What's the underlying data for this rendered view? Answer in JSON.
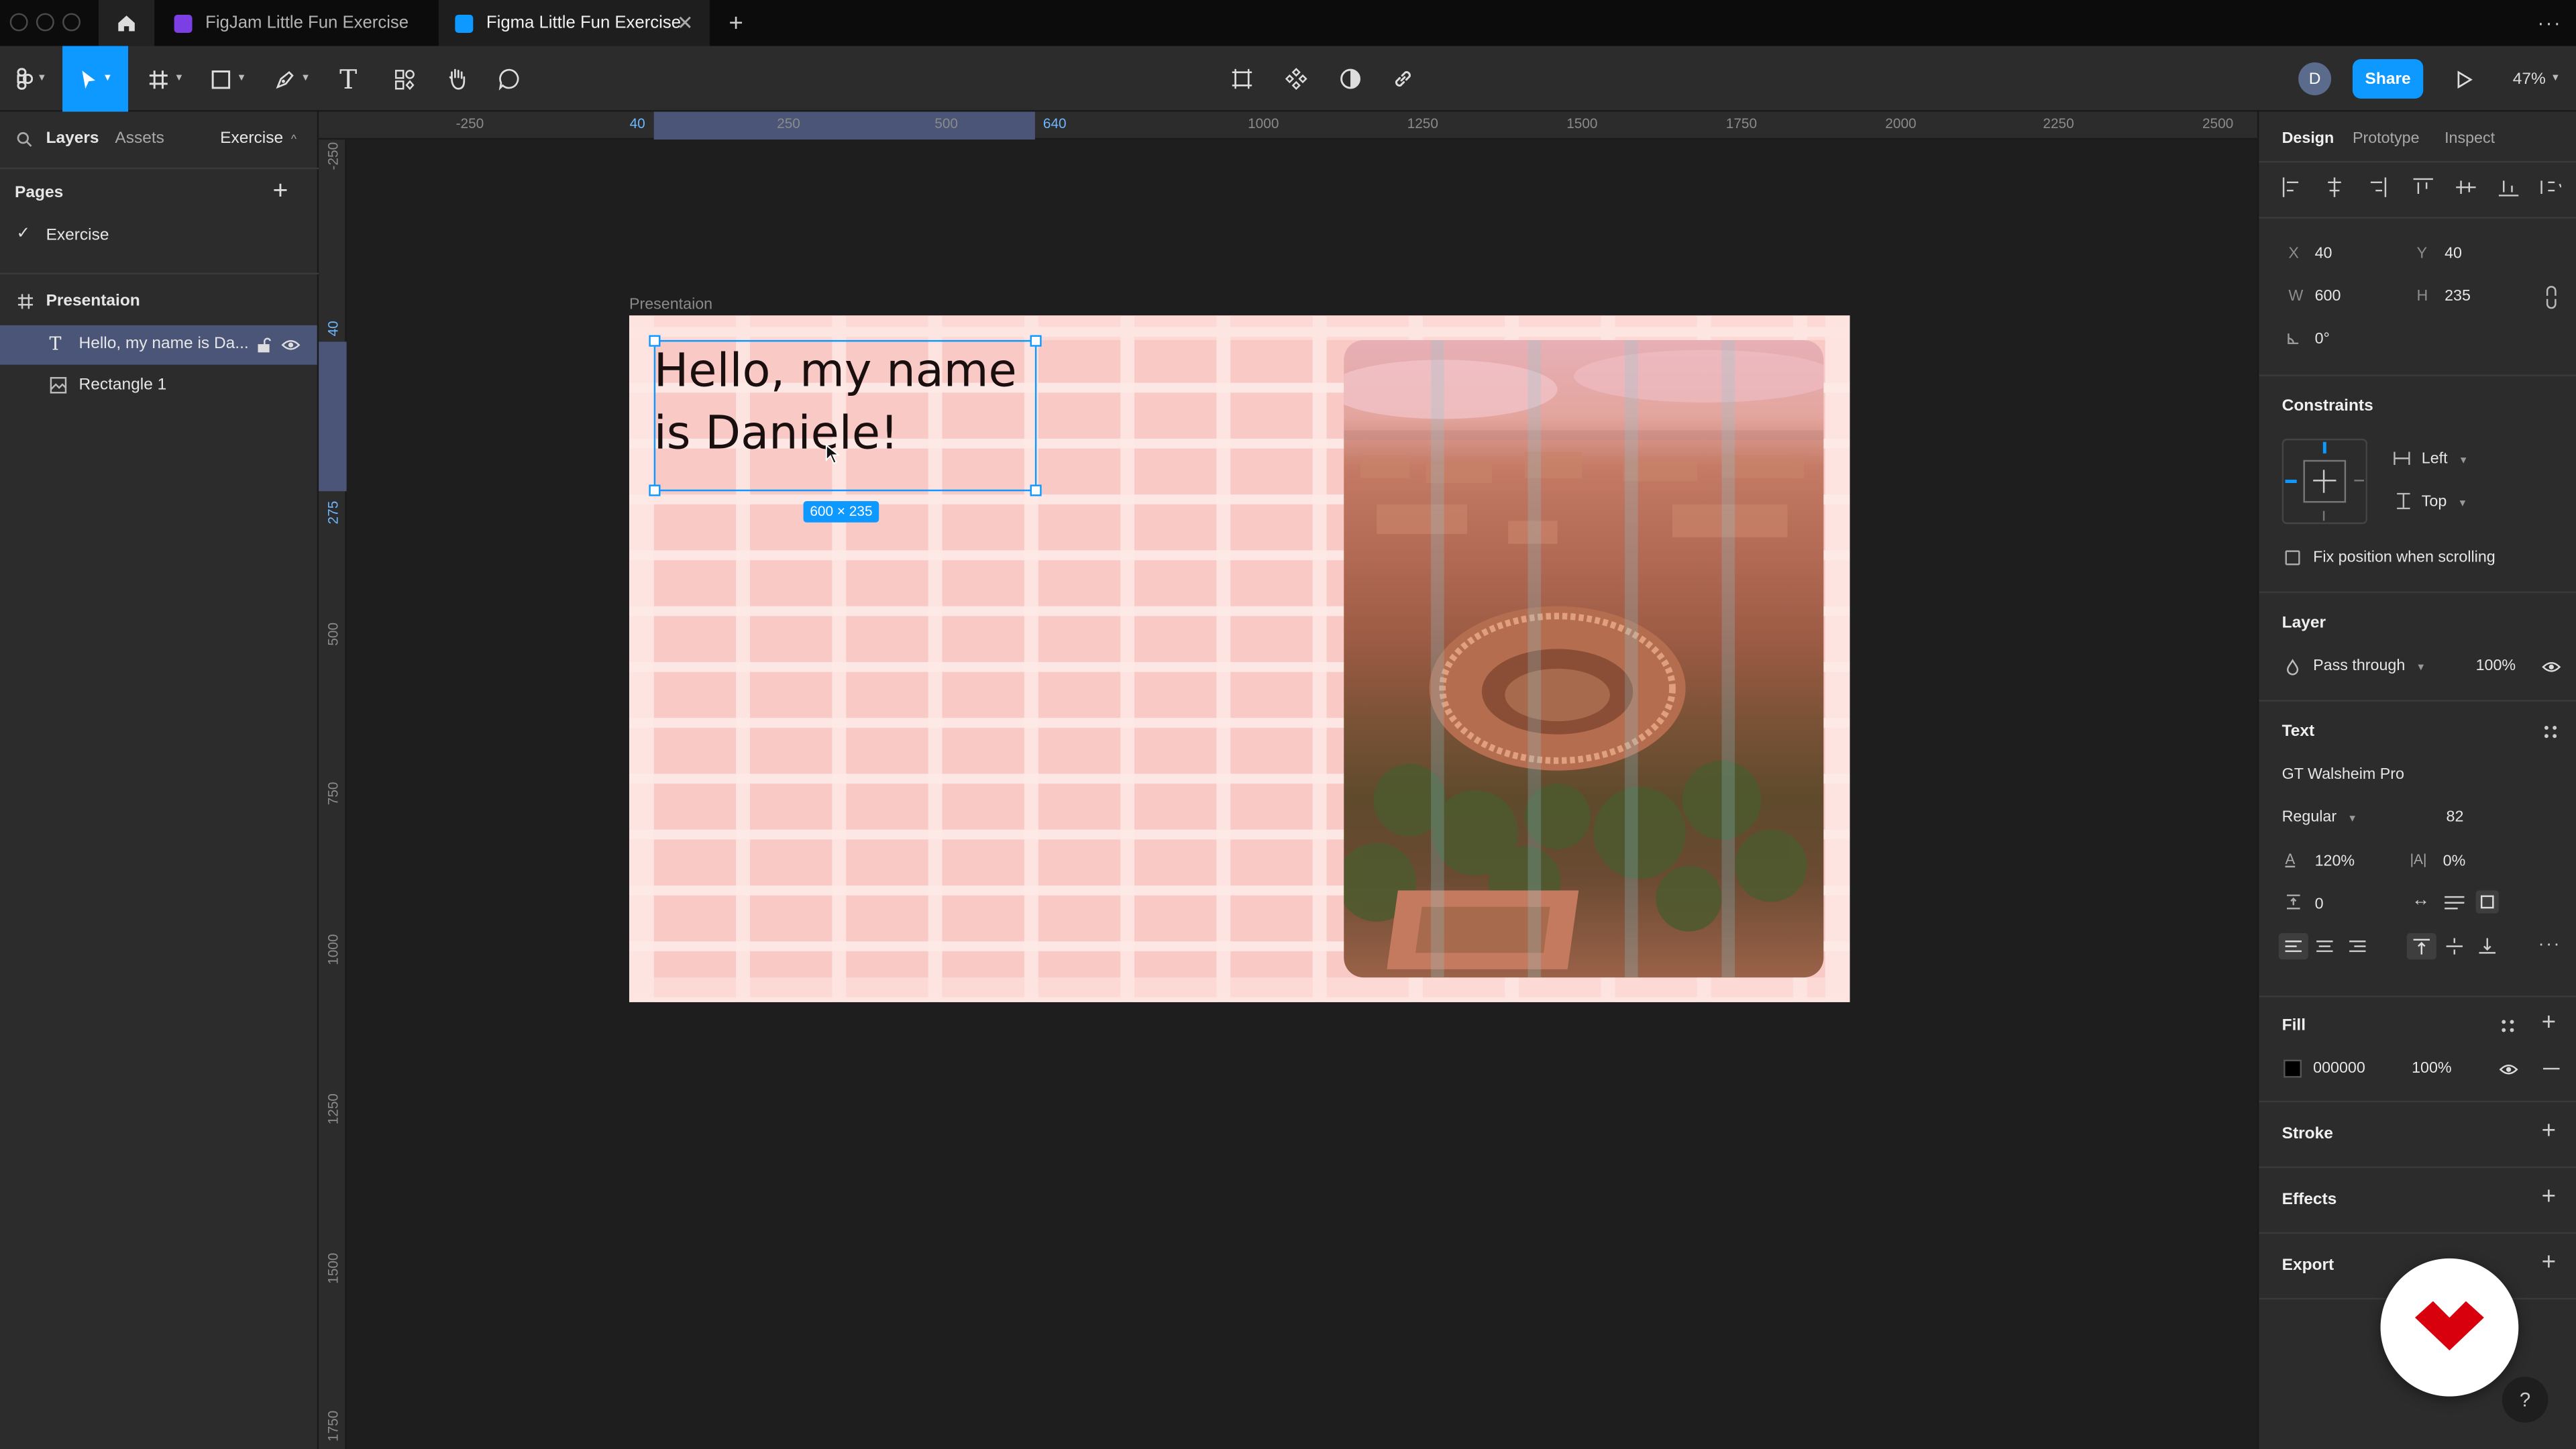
{
  "tabs": [
    {
      "label": "FigJam Little Fun Exercise",
      "active": false
    },
    {
      "label": "Figma Little Fun Exercise",
      "active": true
    }
  ],
  "toolbar": {
    "avatar_letter": "D",
    "share_label": "Share",
    "zoom": "47%"
  },
  "left_panel": {
    "tab_layers": "Layers",
    "tab_assets": "Assets",
    "page_selector": "Exercise",
    "pages_heading": "Pages",
    "pages": [
      {
        "label": "Exercise",
        "selected": true
      }
    ],
    "layers": [
      {
        "label": "Presentaion",
        "type": "frame"
      },
      {
        "label": "Hello, my name is Da...",
        "type": "text",
        "selected": true
      },
      {
        "label": "Rectangle 1",
        "type": "image"
      }
    ]
  },
  "rulers": {
    "top": [
      "-250",
      "40",
      "250",
      "500",
      "640",
      "1000",
      "1250",
      "1500",
      "1750",
      "2000",
      "2250",
      "2500"
    ],
    "left": [
      "-250",
      "40",
      "275",
      "500",
      "750",
      "1000",
      "1250",
      "1500",
      "1750"
    ]
  },
  "canvas": {
    "frame_label": "Presentaion",
    "text_line1": "Hello, my name",
    "text_line2": "is Daniele!",
    "size_badge": "600 × 235"
  },
  "right_panel": {
    "tabs": [
      "Design",
      "Prototype",
      "Inspect"
    ],
    "x_label": "X",
    "x": "40",
    "y_label": "Y",
    "y": "40",
    "w_label": "W",
    "w": "600",
    "h_label": "H",
    "h": "235",
    "rotation": "0°",
    "constraints_heading": "Constraints",
    "constraint_h": "Left",
    "constraint_v": "Top",
    "fix_position_label": "Fix position when scrolling",
    "layer_heading": "Layer",
    "blend_mode": "Pass through",
    "layer_opacity": "100%",
    "text_heading": "Text",
    "font_family": "GT Walsheim Pro",
    "font_weight": "Regular",
    "font_size": "82",
    "line_height": "120%",
    "letter_spacing": "0%",
    "paragraph_spacing": "0",
    "fill_heading": "Fill",
    "fill_hex": "000000",
    "fill_opacity": "100%",
    "stroke_heading": "Stroke",
    "effects_heading": "Effects",
    "export_heading": "Export",
    "help": "?"
  },
  "colors": {
    "accent_blue": "#0d99ff",
    "frame_bg": "#fde4e0",
    "grid_column": "#f9c9c6",
    "share_button": "#0d99ff",
    "fill_swatch": "#000000",
    "brand_red": "#d9000d"
  }
}
